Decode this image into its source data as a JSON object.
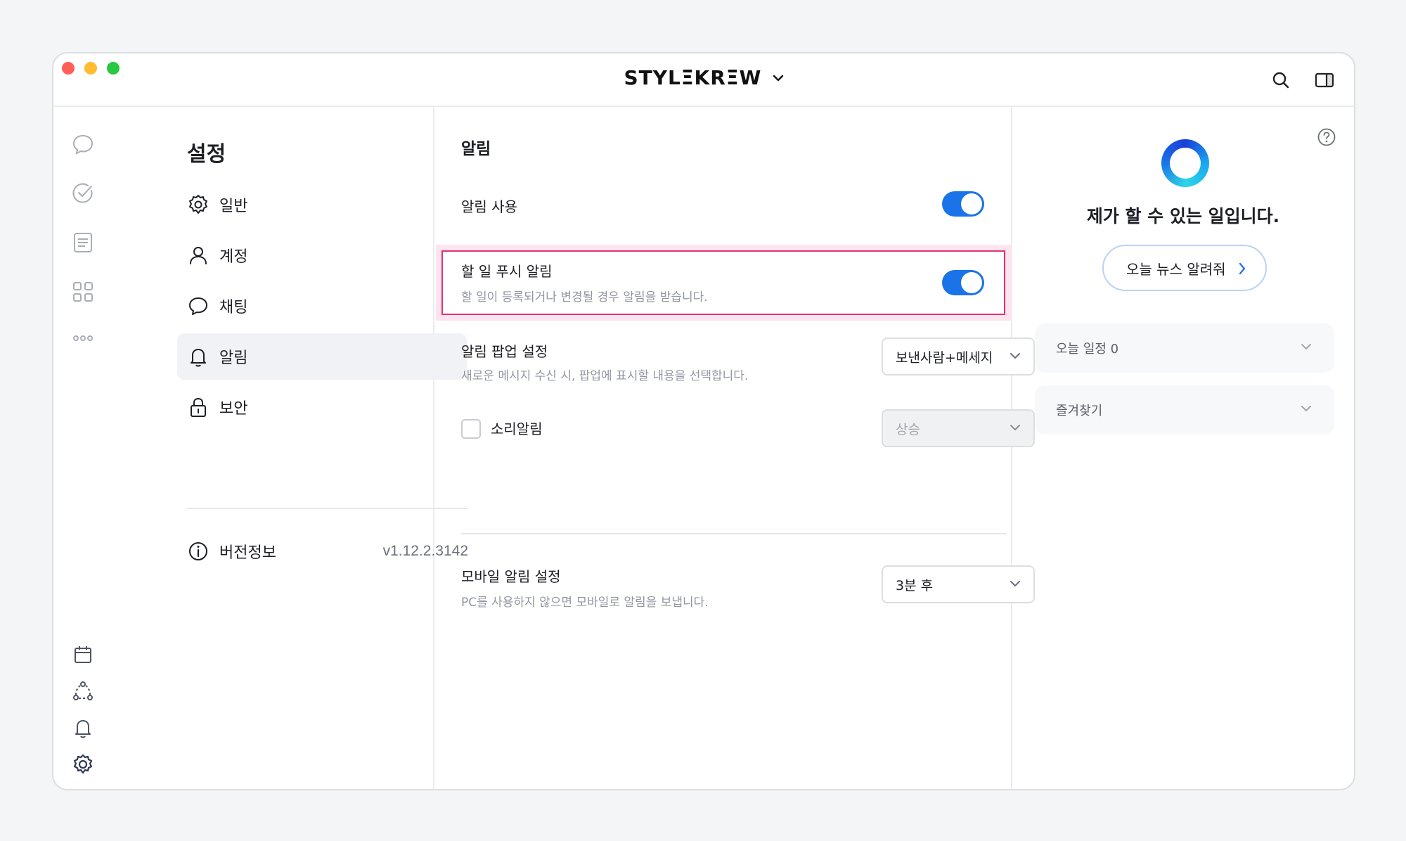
{
  "brand": {
    "name": "STYLΞKRΞW"
  },
  "settings": {
    "title": "설정",
    "menu": [
      {
        "label": "일반",
        "icon": "gear-icon"
      },
      {
        "label": "계정",
        "icon": "person-icon"
      },
      {
        "label": "채팅",
        "icon": "chat-bubble-icon"
      },
      {
        "label": "알림",
        "icon": "bell-icon",
        "active": true
      },
      {
        "label": "보안",
        "icon": "lock-icon"
      }
    ],
    "version_label": "버전정보",
    "version_value": "v1.12.2.3142"
  },
  "notifications": {
    "title": "알림",
    "enable_label": "알림 사용",
    "enable_on": true,
    "todo_push_title": "할 일 푸시 알림",
    "todo_push_desc": "할 일이 등록되거나 변경될 경우 알림을 받습니다.",
    "todo_push_on": true,
    "popup_title": "알림 팝업 설정",
    "popup_desc": "새로운 메시지 수신 시, 팝업에 표시할 내용을 선택합니다.",
    "popup_value": "보낸사람+메세지",
    "sound_label": "소리알림",
    "sound_checked": false,
    "sound_value": "상승",
    "mobile_title": "모바일 알림 설정",
    "mobile_desc": "PC를 사용하지 않으면 모바일로 알림을 보냅니다.",
    "mobile_value": "3분 후"
  },
  "assistant": {
    "title": "제가 할 수 있는 일입니다.",
    "news_button": "오늘 뉴스 알려줘",
    "today_schedule": "오늘 일정 0",
    "favorites": "즐겨찾기"
  },
  "colors": {
    "accent": "#1a73e8",
    "highlight_border": "#e0336f",
    "highlight_bg": "#fde4ee"
  }
}
